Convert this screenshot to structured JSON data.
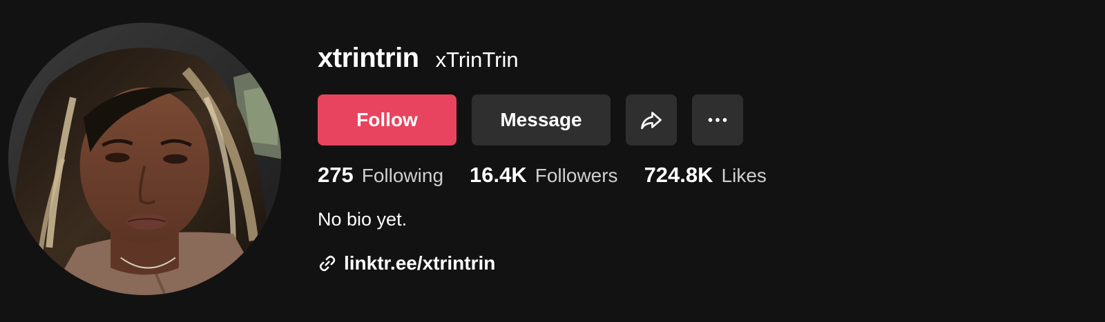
{
  "profile": {
    "username": "xtrintrin",
    "nickname": "xTrinTrin",
    "bio": "No bio yet.",
    "link": "linktr.ee/xtrintrin"
  },
  "actions": {
    "follow_label": "Follow",
    "message_label": "Message",
    "share_icon": "share-icon",
    "more_icon": "more-icon"
  },
  "stats": [
    {
      "value": "275",
      "label": "Following"
    },
    {
      "value": "16.4K",
      "label": "Followers"
    },
    {
      "value": "724.8K",
      "label": "Likes"
    }
  ],
  "colors": {
    "background": "#121212",
    "follow_button": "#e8445f",
    "secondary_button": "#2f2f2f"
  }
}
